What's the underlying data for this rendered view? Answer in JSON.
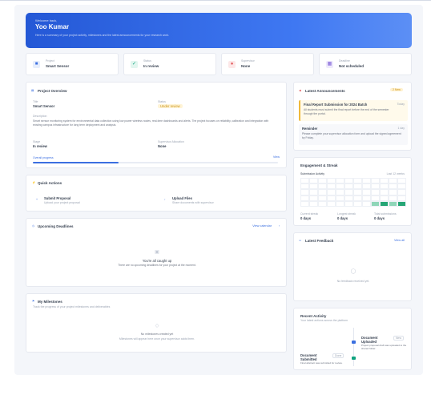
{
  "header": {
    "greeting": "Welcome back,",
    "name": "Yoo Kumar",
    "subtitle": "Here is a summary of your project activity, milestones and the latest announcements for your research work."
  },
  "stats": [
    {
      "label": "Project",
      "value": "Smart Sensor",
      "icon": "folder-icon",
      "color": "#3b6fe0",
      "bg": "#e7eefc"
    },
    {
      "label": "Status",
      "value": "In review",
      "icon": "check-icon",
      "color": "#10a37f",
      "bg": "#e2f6ef"
    },
    {
      "label": "Supervisor",
      "value": "None",
      "icon": "user-icon",
      "color": "#e2595c",
      "bg": "#fde8e8"
    },
    {
      "label": "Deadline",
      "value": "Not scheduled",
      "icon": "calendar-icon",
      "color": "#7c5cd6",
      "bg": "#efeafc"
    }
  ],
  "project_overview": {
    "title": "Project Overview",
    "title_label": "Title",
    "title_value": "Smart Sensor",
    "status_label": "Status",
    "status_value": "Under review",
    "description_label": "Description",
    "description": "Smart sensor monitoring system for environmental data collection using low power wireless nodes, real-time dashboards and alerts. The project focuses on reliability, calibration and integration with existing campus infrastructure for long term deployment and analysis.",
    "stage_label": "Stage",
    "stage_value": "In review",
    "supervisor_label": "Supervisor Allocation",
    "supervisor_value": "None",
    "progress_label": "Overall progress",
    "progress_fraction": 0.35,
    "view_link": "View"
  },
  "quick_actions": {
    "title": "Quick Actions",
    "items": [
      {
        "label": "Submit Proposal",
        "sub": "Upload your project proposal"
      },
      {
        "label": "Upload Files",
        "sub": "Share documents with supervisor"
      }
    ]
  },
  "upcoming_deadlines": {
    "title": "Upcoming Deadlines",
    "link": "View calendar",
    "empty_title": "You're all caught up",
    "empty_sub": "There are no upcoming deadlines for your project at the moment."
  },
  "milestones": {
    "title": "My Milestones",
    "subtitle": "Track the progress of your project milestones and deliverables",
    "empty_title": "No milestones created yet",
    "empty_sub": "Milestones will appear here once your supervisor adds them."
  },
  "announcements": {
    "title": "Latest Announcements",
    "badge": "2 New",
    "items": [
      {
        "title": "Final Report Submission for 2024 Batch",
        "date": "Today",
        "body": "All students must submit the final report before the end of the semester through the portal."
      },
      {
        "title": "Reminder",
        "date": "1 day",
        "body": "Please complete your supervisor allocation form and upload the signed agreement by Friday."
      }
    ]
  },
  "engagement": {
    "title": "Engagement & Streak",
    "chart_title": "Submission Activity",
    "chart_link": "Last 12 weeks",
    "metrics": [
      {
        "label": "Current streak",
        "value": "0 days"
      },
      {
        "label": "Longest streak",
        "value": "0 days"
      },
      {
        "label": "Total submissions",
        "value": "0 days"
      }
    ]
  },
  "feedback": {
    "title": "Latest Feedback",
    "link": "View all",
    "empty": "No feedback received yet."
  },
  "recent_activity": {
    "title": "Recent Activity",
    "subtitle": "Your latest actions across the platform",
    "items": [
      {
        "title": "Document Uploaded",
        "tag": "New",
        "body": "Project proposal draft was uploaded to the shared folder."
      },
      {
        "title": "Document Submitted",
        "tag": "Done",
        "body": "Final abstract was submitted for review."
      }
    ]
  }
}
